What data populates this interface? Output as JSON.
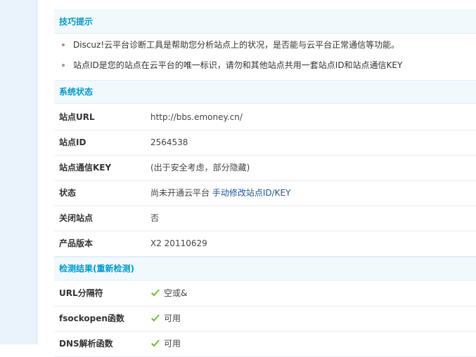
{
  "tips": {
    "title": "技巧提示",
    "items": [
      "Discuz!云平台诊断工具是帮助您分析站点上的状况，是否能与云平台正常通信等功能。",
      "站点ID是您的站点在云平台的唯一标识，请勿和其他站点共用一套站点ID和站点通信KEY"
    ]
  },
  "status": {
    "title": "系统状态",
    "rows": [
      {
        "label": "站点URL",
        "value": "http://bbs.emoney.cn/"
      },
      {
        "label": "站点ID",
        "value": "2564538"
      },
      {
        "label": "站点通信KEY",
        "value": "(出于安全考虑，部分隐藏)"
      },
      {
        "label": "状态",
        "value": "尚未开通云平台",
        "link": "手动修改站点ID/KEY"
      },
      {
        "label": "关闭站点",
        "value": "否"
      },
      {
        "label": "产品版本",
        "value": "X2 20110629"
      }
    ]
  },
  "results": {
    "title": "检测结果(重新检测)",
    "rows": [
      {
        "label": "URL分隔符",
        "value": "空或&"
      },
      {
        "label": "fsockopen函数",
        "value": "可用"
      },
      {
        "label": "DNS解析函数",
        "value": "可用"
      }
    ]
  },
  "icons": {
    "check": "check-icon"
  },
  "colors": {
    "accent": "#0099cc",
    "link": "#1e5494",
    "check": "#6bbf2a",
    "header_bg": "#f2f9fd"
  }
}
